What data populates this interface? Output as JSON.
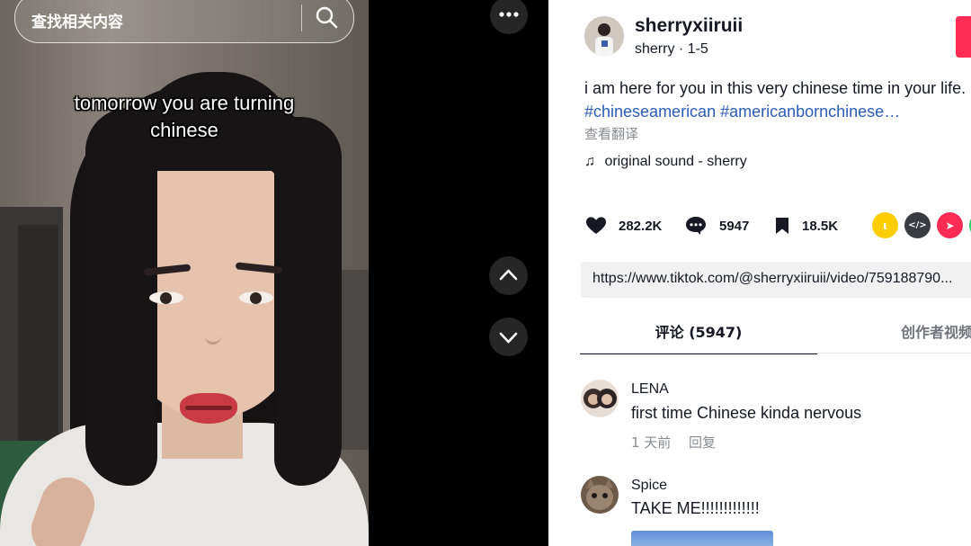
{
  "search": {
    "placeholder": "查找相关内容"
  },
  "video": {
    "caption": "tomorrow you are turning chinese"
  },
  "controls": {
    "more_label": "•••"
  },
  "author": {
    "username": "sherryxiiruii",
    "meta": "sherry · 1-5"
  },
  "post": {
    "description": "i am here for you in this very chinese time in your life.",
    "hashtags": "#chineseamerican #americanbornchinese…",
    "translate_label": "查看翻译",
    "music": "original sound - sherry",
    "music_icon": "♫"
  },
  "stats": {
    "likes": "282.2K",
    "comments": "5947",
    "saves": "18.5K"
  },
  "share_icons": [
    {
      "name": "share-icon-yellow",
      "color": "#fece00",
      "glyph": "ι"
    },
    {
      "name": "embed-icon",
      "color": "#3a3b41",
      "glyph": "</>"
    },
    {
      "name": "send-icon",
      "color": "#fe2c55",
      "glyph": "➤"
    }
  ],
  "link": {
    "url": "https://www.tiktok.com/@sherryxiiruii/video/759188790..."
  },
  "tabs": {
    "comments": "评论 (5947)",
    "creator_videos": "创作者视频"
  },
  "comments": [
    {
      "user": "LENA",
      "text": "first time Chinese kinda nervous",
      "time": "1 天前",
      "reply": "回复"
    },
    {
      "user": "Spice",
      "text": "TAKE ME!!!!!!!!!!!!!"
    }
  ]
}
